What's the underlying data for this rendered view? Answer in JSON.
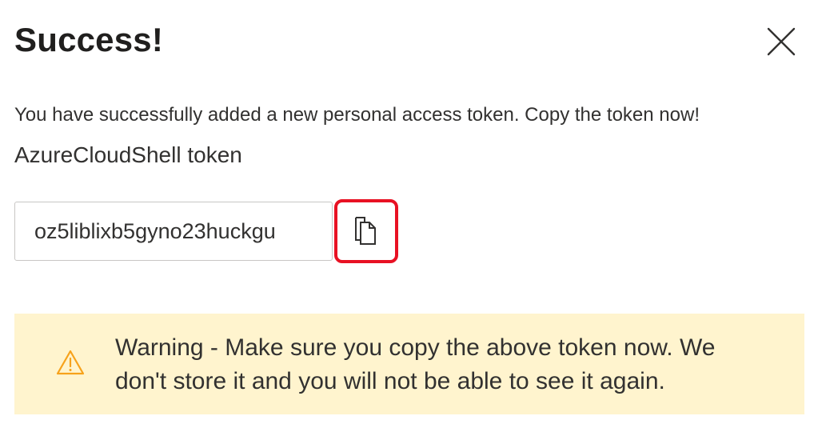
{
  "dialog": {
    "title": "Success!",
    "close_icon": "close-icon"
  },
  "message": "You have successfully added a new personal access token. Copy the token now!",
  "token": {
    "name": "AzureCloudShell token",
    "value": "oz5liblixb5gyno23huckgu",
    "copy_icon": "copy-icon",
    "copy_button_highlight_color": "#e81123"
  },
  "warning": {
    "icon": "warning-icon",
    "text": "Warning - Make sure you copy the above token now. We don't store it and you will not be able to see it again.",
    "background_color": "#fff4ce",
    "icon_color": "#f7a21b"
  }
}
